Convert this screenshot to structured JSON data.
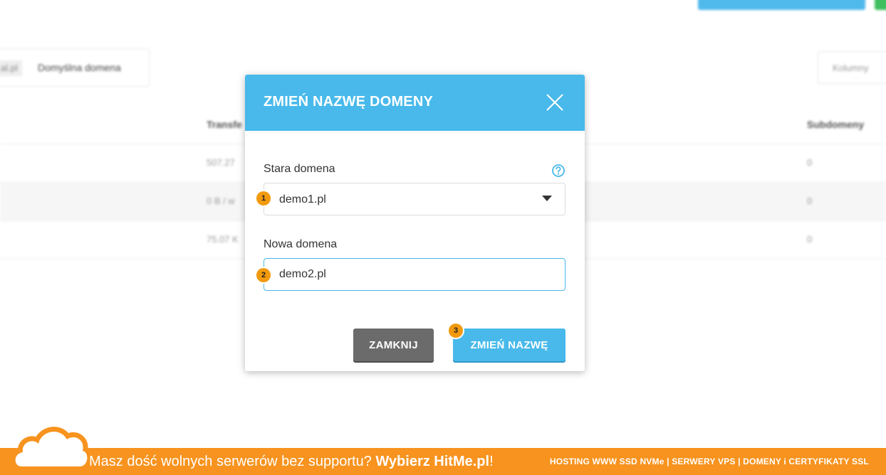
{
  "background": {
    "tabs": {
      "active_partial": "al.pl",
      "default_domain": "Domyślna domena"
    },
    "columns_button": "Kolumny",
    "table": {
      "headers": {
        "transfer_partial": "Transfe",
        "subdomains": "Subdomeny"
      },
      "rows": [
        {
          "transfer": "507.27",
          "subdomains": "0"
        },
        {
          "transfer": "0 B / w",
          "subdomains": "0"
        },
        {
          "transfer": "75.07 K",
          "subdomains": "0"
        }
      ]
    }
  },
  "modal": {
    "title": "ZMIEŃ NAZWĘ DOMENY",
    "old_domain": {
      "label": "Stara domena",
      "value": "demo1.pl",
      "step": "1"
    },
    "new_domain": {
      "label": "Nowa domena",
      "value": "demo2.pl",
      "step": "2"
    },
    "buttons": {
      "close": "ZAMKNIJ",
      "rename": "ZMIEŃ NAZWĘ",
      "rename_step": "3"
    }
  },
  "footer": {
    "text_regular": "Masz dość wolnych serwerów bez supportu? ",
    "text_bold": "Wybierz HitMe.pl",
    "text_end": "!",
    "right_text": "HOSTING WWW SSD NVMe | SERWERY VPS | DOMENY i CERTYFIKATY SSL"
  },
  "colors": {
    "accent": "#48b9ea",
    "badge": "#f29a0e",
    "footer": "#f7931e",
    "close_button": "#6b6b6b"
  }
}
